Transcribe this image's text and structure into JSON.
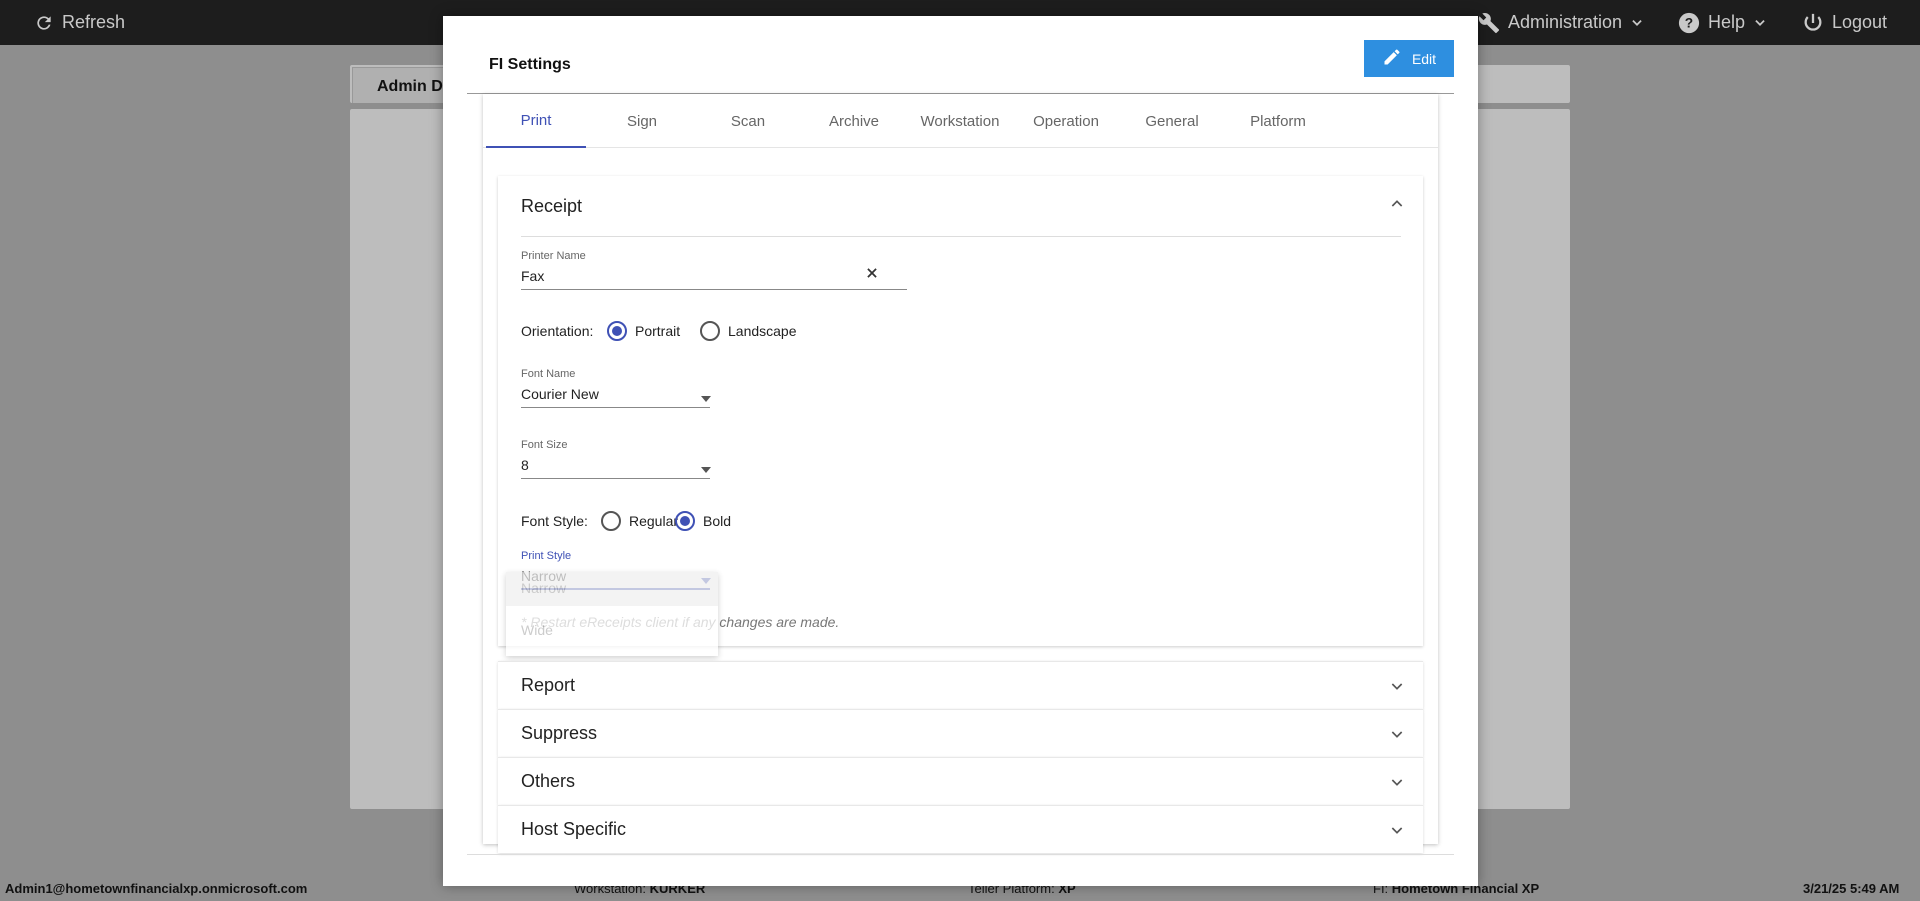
{
  "topbar": {
    "refresh_label": "Refresh",
    "administration_label": "Administration",
    "help_label": "Help",
    "logout_label": "Logout"
  },
  "background": {
    "tab_label": "Admin D"
  },
  "footer": {
    "user": "Admin1@hometownfinancialxp.onmicrosoft.com",
    "workstation_label": "Workstation:",
    "workstation_value": "KURKER",
    "platform_label": "Teller Platform:",
    "platform_value": "XP",
    "fi_label": "FI:",
    "fi_value": "Hometown Financial XP",
    "datetime": "3/21/25 5:49 AM"
  },
  "modal": {
    "title": "FI Settings",
    "edit_label": "Edit",
    "tabs": [
      "Print",
      "Sign",
      "Scan",
      "Archive",
      "Workstation",
      "Operation",
      "General",
      "Platform"
    ],
    "active_tab": "Print"
  },
  "receipt": {
    "title": "Receipt",
    "printer_name_label": "Printer Name",
    "printer_name_value": "Fax",
    "orientation_label": "Orientation:",
    "orientation_options": [
      "Portrait",
      "Landscape"
    ],
    "orientation_selected": "Portrait",
    "font_name_label": "Font Name",
    "font_name_value": "Courier New",
    "font_size_label": "Font Size",
    "font_size_value": "8",
    "font_style_label": "Font Style:",
    "font_style_options": [
      "Regular",
      "Bold"
    ],
    "font_style_selected": "Bold",
    "print_style_label": "Print Style",
    "print_style_value": "Narrow",
    "print_style_options": [
      "Narrow",
      "Wide"
    ],
    "note": "* Restart eReceipts client if any changes are made."
  },
  "sections": [
    "Report",
    "Suppress",
    "Others",
    "Host Specific"
  ],
  "colors": {
    "accent": "#3f51b5",
    "edit_button": "#2e8fe0",
    "topbar": "#1d1d1d"
  }
}
